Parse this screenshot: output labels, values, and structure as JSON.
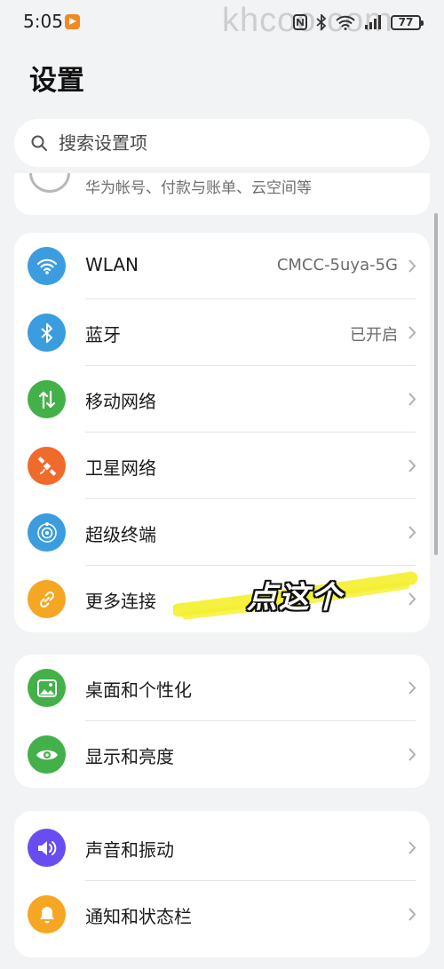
{
  "status": {
    "time": "5:05",
    "battery": "77",
    "watermark": "khcoo.com"
  },
  "header": {
    "title": "设置"
  },
  "search": {
    "placeholder": "搜索设置项"
  },
  "account": {
    "subtitle": "华为帐号、付款与账单、云空间等"
  },
  "connectivity": [
    {
      "label": "WLAN",
      "value": "CMCC-5uya-5G",
      "icon": "wifi-icon",
      "color": "#3b9ddf"
    },
    {
      "label": "蓝牙",
      "value": "已开启",
      "icon": "bluetooth-icon",
      "color": "#3b9ddf"
    },
    {
      "label": "移动网络",
      "value": "",
      "icon": "mobile-data-icon",
      "color": "#43b04a"
    },
    {
      "label": "卫星网络",
      "value": "",
      "icon": "satellite-icon",
      "color": "#f06a2b"
    },
    {
      "label": "超级终端",
      "value": "",
      "icon": "super-device-icon",
      "color": "#3b9ddf"
    },
    {
      "label": "更多连接",
      "value": "",
      "icon": "link-icon",
      "color": "#f5a623"
    }
  ],
  "display": [
    {
      "label": "桌面和个性化",
      "icon": "wallpaper-icon",
      "color": "#43b04a"
    },
    {
      "label": "显示和亮度",
      "icon": "eye-icon",
      "color": "#43b04a"
    }
  ],
  "sound": [
    {
      "label": "声音和振动",
      "icon": "speaker-icon",
      "color": "#6a4df0"
    },
    {
      "label": "通知和状态栏",
      "icon": "bell-icon",
      "color": "#f5a623"
    }
  ],
  "annotation": {
    "text": "点这个",
    "highlight_color": "#f4f02e"
  }
}
